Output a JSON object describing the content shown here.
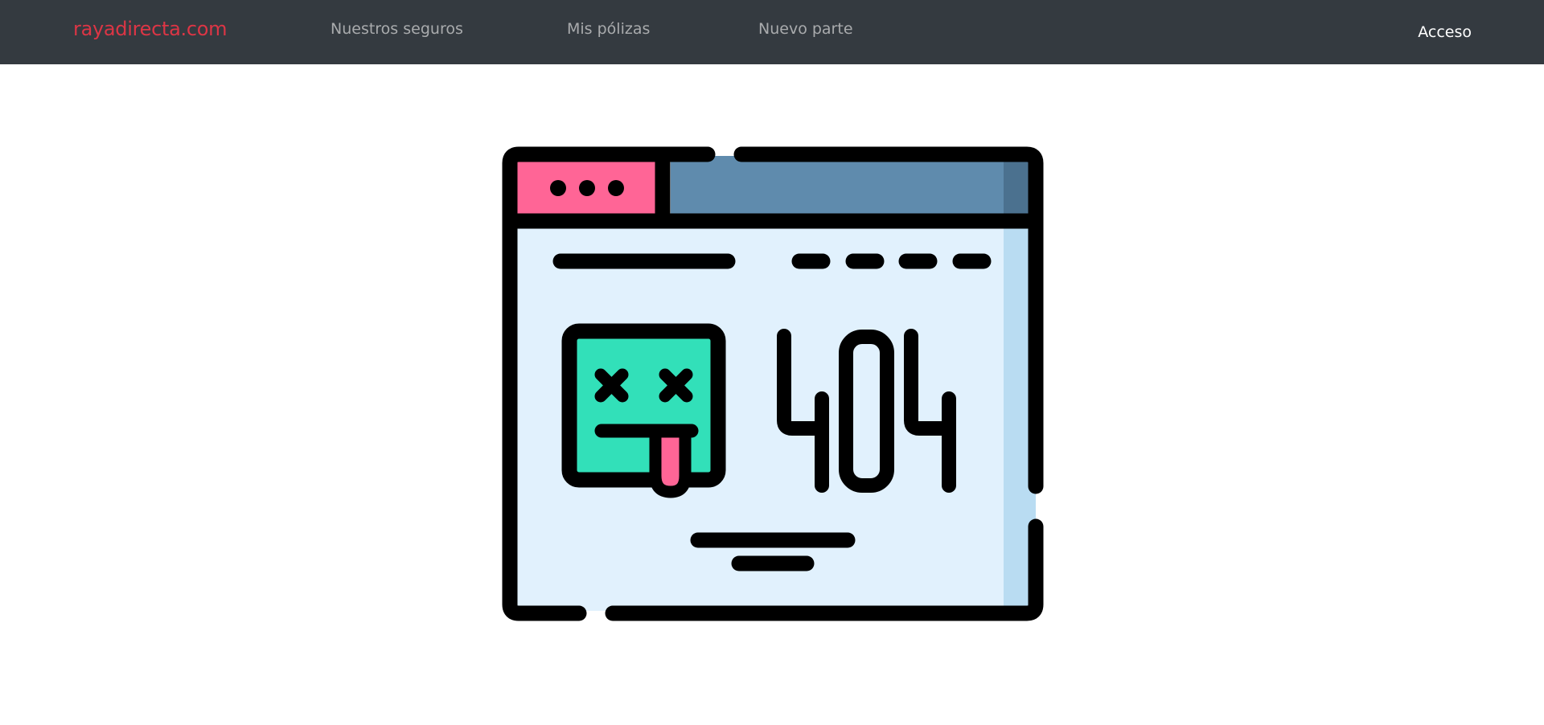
{
  "navbar": {
    "brand": "rayadirecta.com",
    "links": [
      "Nuestros seguros",
      "Mis pólizas",
      "Nuevo parte"
    ],
    "login": "Acceso"
  },
  "illustration": {
    "error_code": "404",
    "colors": {
      "window_bg": "#e1f1fd",
      "window_side": "#b9dcf2",
      "titlebar": "#5f8bad",
      "titlebar_end": "#4b718f",
      "tab": "#ff6596",
      "face": "#32e0b9",
      "tongue": "#ff6596",
      "outline": "#000000"
    }
  }
}
